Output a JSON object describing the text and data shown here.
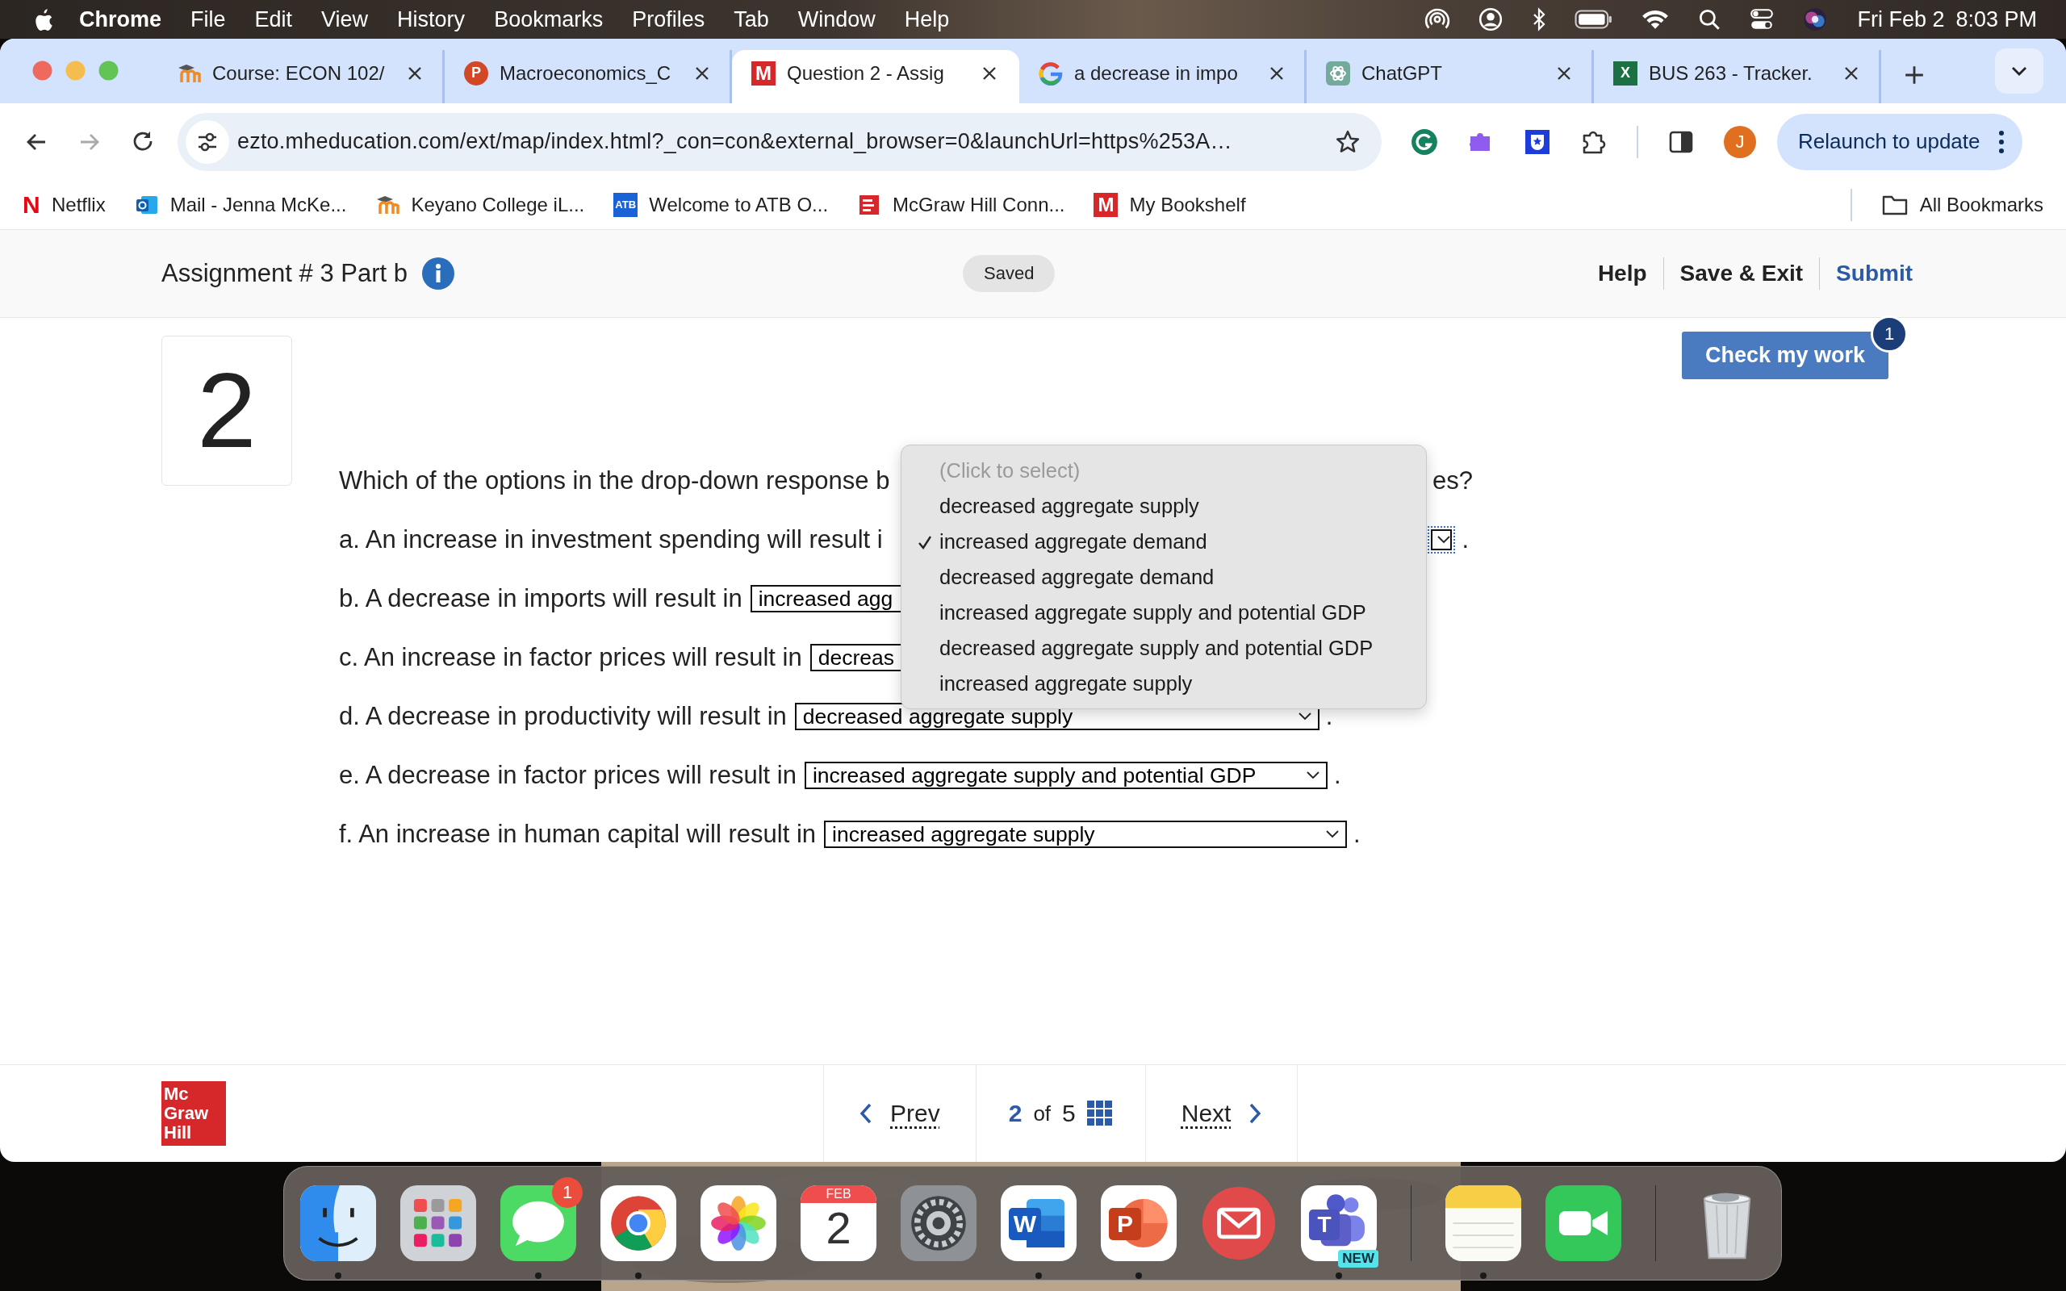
{
  "menu_bar": {
    "app": "Chrome",
    "menus": [
      "File",
      "Edit",
      "View",
      "History",
      "Bookmarks",
      "Profiles",
      "Tab",
      "Window",
      "Help"
    ],
    "status_icons": [
      {
        "kind": "airdrop"
      },
      {
        "kind": "user"
      },
      {
        "kind": "bluetooth"
      },
      {
        "kind": "battery"
      },
      {
        "kind": "wifi"
      },
      {
        "kind": "search"
      },
      {
        "kind": "control"
      },
      {
        "kind": "siri"
      }
    ],
    "date": "Fri Feb 2",
    "time": "8:03 PM"
  },
  "tabs": [
    {
      "title": "Course: ECON 102/",
      "kind": "moodle",
      "selected": false
    },
    {
      "title": "Macroeconomics_C",
      "kind": "powerpoint",
      "glyph": "P",
      "selected": false
    },
    {
      "title": "Question 2 - Assig",
      "kind": "mcgraw",
      "glyph": "M",
      "selected": true
    },
    {
      "title": "a decrease in impo",
      "kind": "google",
      "selected": false
    },
    {
      "title": "ChatGPT",
      "kind": "chatgpt",
      "selected": false
    },
    {
      "title": "BUS 263 - Tracker.",
      "kind": "excel",
      "glyph": "X",
      "selected": false
    }
  ],
  "address_bar": {
    "url": "ezto.mheducation.com/ext/map/index.html?_con=con&external_browser=0&launchUrl=https%253A…"
  },
  "extensions": [
    {
      "kind": "grammarly"
    },
    {
      "kind": "rw"
    },
    {
      "kind": "shield"
    },
    {
      "kind": "puzzle"
    }
  ],
  "profile_initial": "J",
  "relaunch_button": "Relaunch to update",
  "bookmarks": [
    {
      "label": "Netflix",
      "kind": "netflix",
      "glyph": "N"
    },
    {
      "label": "Mail - Jenna McKe...",
      "kind": "outlook"
    },
    {
      "label": "Keyano College iL...",
      "kind": "moodle"
    },
    {
      "label": "Welcome to ATB O...",
      "kind": "atb",
      "glyph": "ATB"
    },
    {
      "label": "McGraw Hill Conn...",
      "kind": "mhe"
    },
    {
      "label": "My Bookshelf",
      "kind": "mcgraw",
      "glyph": "M"
    }
  ],
  "all_bookmarks": "All Bookmarks",
  "header": {
    "title": "Assignment # 3 Part b",
    "status": "Saved",
    "actions": [
      {
        "label": "Help",
        "kind": "plain"
      },
      {
        "label": "Save & Exit",
        "kind": "plain"
      },
      {
        "label": "Submit",
        "kind": "primary"
      }
    ]
  },
  "check_button": {
    "label": "Check my work",
    "badge": "1"
  },
  "question": {
    "number": "2",
    "prompt_start": "Which of the options in the drop-down response b",
    "prompt_end": "es?",
    "items": [
      {
        "text": "a. An increase in investment spending will result i",
        "focused": true,
        "end": "."
      },
      {
        "text": "b. A decrease in imports will result in",
        "answer": "increased agg",
        "focused": false
      },
      {
        "text": "c. An increase in factor prices will result in",
        "answer": "decreas",
        "focused": false
      },
      {
        "text": "d. A decrease in productivity will result in",
        "answer": "decreased aggregate supply",
        "focused": false,
        "end": "."
      },
      {
        "text": "e. A decrease in factor prices will result in",
        "answer": "increased aggregate supply and potential GDP",
        "focused": false,
        "end": "."
      },
      {
        "text": "f. An increase in human capital will result in",
        "answer": "increased aggregate supply",
        "focused": false,
        "end": "."
      }
    ]
  },
  "dropdown_menu": {
    "options": [
      {
        "label": "(Click to select)",
        "kind": "placeholder",
        "selected": false
      },
      {
        "label": "decreased aggregate supply",
        "kind": "option",
        "selected": false
      },
      {
        "label": "increased aggregate demand",
        "kind": "option",
        "selected": true
      },
      {
        "label": "decreased aggregate demand",
        "kind": "option",
        "selected": false
      },
      {
        "label": "increased aggregate supply and potential GDP",
        "kind": "option",
        "selected": false
      },
      {
        "label": "decreased aggregate supply and potential GDP",
        "kind": "option",
        "selected": false
      },
      {
        "label": "increased aggregate supply",
        "kind": "option",
        "selected": false
      }
    ]
  },
  "footer": {
    "logo_lines": [
      "Mc",
      "Graw",
      "Hill"
    ],
    "prev": "Prev",
    "page": "2",
    "of": "of",
    "total": "5",
    "next": "Next"
  },
  "dock": [
    {
      "kind": "finder",
      "running": true
    },
    {
      "kind": "launchpad",
      "running": false
    },
    {
      "kind": "messages",
      "running": true,
      "badge": "1"
    },
    {
      "kind": "chrome",
      "running": true
    },
    {
      "kind": "photos",
      "running": false
    },
    {
      "kind": "calendar",
      "running": false,
      "month": "FEB",
      "day": "2"
    },
    {
      "kind": "settings",
      "running": false
    },
    {
      "kind": "word",
      "running": true,
      "glyph": "W"
    },
    {
      "kind": "powerpoint",
      "running": true,
      "glyph": "P"
    },
    {
      "kind": "mail",
      "running": false
    },
    {
      "kind": "teams",
      "running": true,
      "glyph": "T",
      "badge": "NEW"
    },
    {
      "kind": "separator"
    },
    {
      "kind": "notes",
      "running": true
    },
    {
      "kind": "facetime",
      "running": false
    },
    {
      "kind": "separator"
    },
    {
      "kind": "trash",
      "running": false
    }
  ]
}
